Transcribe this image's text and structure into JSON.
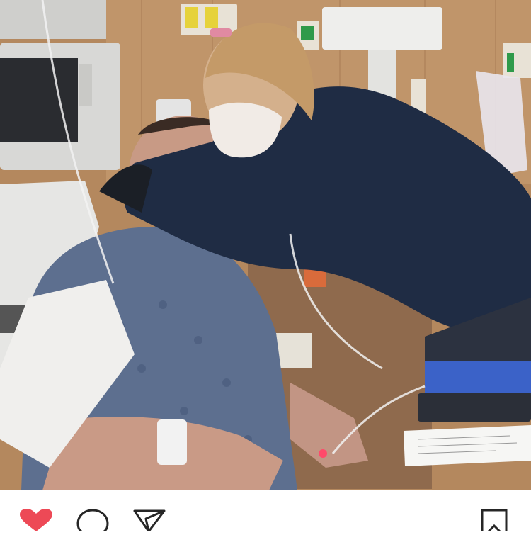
{
  "post": {
    "photo": {
      "icon": "photo",
      "description_for_accessibility": ""
    },
    "actions": {
      "like": {
        "icon": "heart-filled-icon",
        "color": "#ed4956",
        "active": true
      },
      "comment": {
        "icon": "speech-bubble-icon"
      },
      "share": {
        "icon": "paper-plane-icon"
      },
      "save": {
        "icon": "bookmark-icon"
      }
    }
  },
  "theme": {
    "background": "#ffffff",
    "icon_stroke": "#262626",
    "accent": "#ed4956"
  }
}
